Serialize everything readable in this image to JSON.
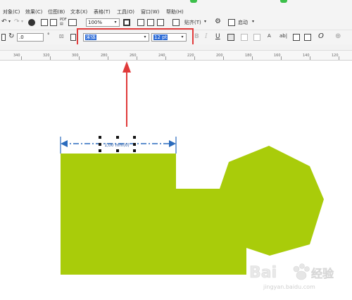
{
  "menubar": {
    "items": [
      {
        "label": "对象(C)"
      },
      {
        "label": "效果(C)"
      },
      {
        "label": "位图(B)"
      },
      {
        "label": "文本(X)"
      },
      {
        "label": "表格(T)"
      },
      {
        "label": "工具(O)"
      },
      {
        "label": "窗口(W)"
      },
      {
        "label": "帮助(H)"
      }
    ]
  },
  "toolbar1": {
    "zoom_value": "100%",
    "snap_label": "贴齐(T)",
    "launch_label": "启动"
  },
  "toolbar2": {
    "rotation_value": ".0",
    "degree_symbol": "°",
    "font_name": "宋体",
    "font_size": "12 pt",
    "italic_label": "I",
    "underline_label": "U",
    "bold_label": "B",
    "char_label": "A",
    "abl_label": "ab|"
  },
  "ruler": {
    "labels": [
      "340",
      "320",
      "300",
      "280",
      "260",
      "240",
      "220",
      "200",
      "180",
      "160",
      "140",
      "120"
    ]
  },
  "canvas": {
    "dimension_text": "1,00 mm(0)",
    "shape_fill": "#a9cc0a",
    "arrow_color": "#e03a3a",
    "dim_line_color": "#2a6bbd"
  },
  "highlight": {
    "color": "#e23c3c"
  },
  "watermark": {
    "brand": "Bai",
    "brand_suffix": "经验",
    "url": "jingyan.baidu.com"
  }
}
